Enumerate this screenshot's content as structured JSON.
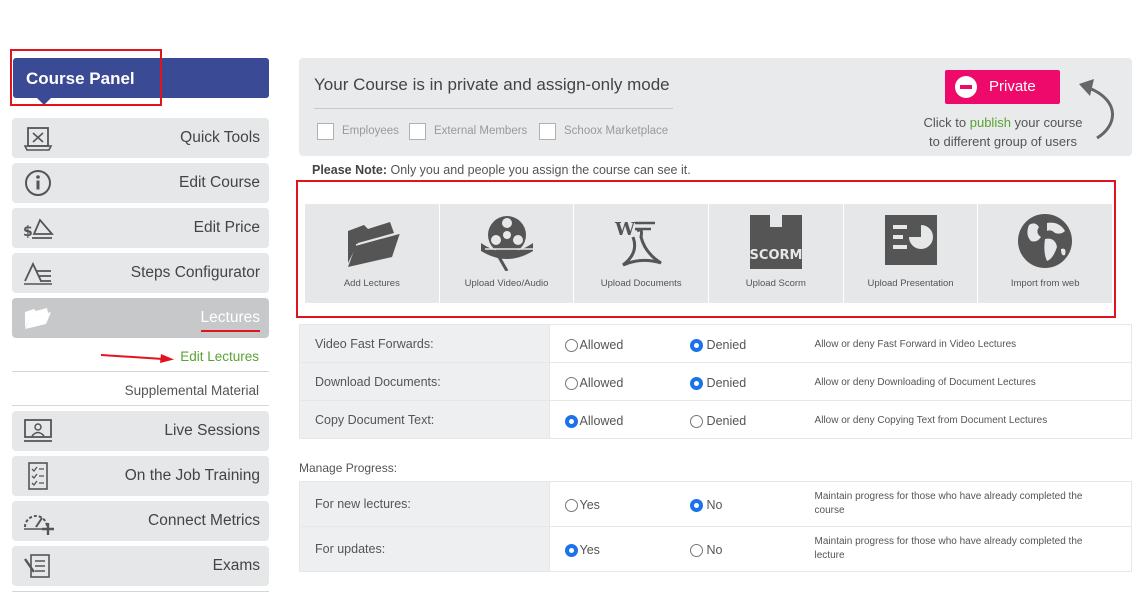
{
  "sidebar": {
    "panel_title": "Course Panel",
    "items": [
      {
        "label": "Quick Tools",
        "icon": "quick-tools-icon"
      },
      {
        "label": "Edit Course",
        "icon": "info-icon"
      },
      {
        "label": "Edit Price",
        "icon": "price-icon"
      },
      {
        "label": "Steps Configurator",
        "icon": "steps-icon"
      },
      {
        "label": "Lectures",
        "icon": "folder-icon",
        "active": true
      },
      {
        "label": "Live Sessions",
        "icon": "live-session-icon"
      },
      {
        "label": "On the Job Training",
        "icon": "checklist-icon"
      },
      {
        "label": "Connect Metrics",
        "icon": "gauge-icon"
      },
      {
        "label": "Exams",
        "icon": "exam-icon"
      }
    ],
    "sub_items": {
      "edit_lectures": "Edit Lectures",
      "supplemental": "Supplemental Material"
    }
  },
  "mode": {
    "title": "Your Course is in private and assign-only mode",
    "audiences": [
      "Employees",
      "External Members",
      "Schoox Marketplace"
    ],
    "private_button": "Private",
    "note_prefix": "Click to ",
    "note_link": "publish",
    "note_suffix": " your course",
    "note_line2": "to different group of users"
  },
  "please_note": {
    "bold": "Please Note:",
    "text": " Only you and people you assign the course can see it."
  },
  "tiles": [
    {
      "label": "Add Lectures",
      "icon": "folder-icon"
    },
    {
      "label": "Upload Video/Audio",
      "icon": "film-reel-icon"
    },
    {
      "label": "Upload Documents",
      "icon": "documents-icon"
    },
    {
      "label": "Upload Scorm",
      "icon": "scorm-box-icon"
    },
    {
      "label": "Upload Presentation",
      "icon": "presentation-icon"
    },
    {
      "label": "Import from web",
      "icon": "globe-icon"
    }
  ],
  "settings": [
    {
      "label": "Video Fast Forwards:",
      "options": [
        "Allowed",
        "Denied"
      ],
      "selected": "Denied",
      "desc": "Allow or deny Fast Forward in Video Lectures"
    },
    {
      "label": "Download Documents:",
      "options": [
        "Allowed",
        "Denied"
      ],
      "selected": "Denied",
      "desc": "Allow or deny Downloading of Document Lectures"
    },
    {
      "label": "Copy Document Text:",
      "options": [
        "Allowed",
        "Denied"
      ],
      "selected": "Allowed",
      "desc": "Allow or deny Copying Text from Document Lectures"
    }
  ],
  "manage_progress": {
    "title": "Manage Progress:",
    "rows": [
      {
        "label": "For new lectures:",
        "options": [
          "Yes",
          "No"
        ],
        "selected": "No",
        "desc": "Maintain progress for those who have already completed the course"
      },
      {
        "label": "For updates:",
        "options": [
          "Yes",
          "No"
        ],
        "selected": "Yes",
        "desc": "Maintain progress for those who have already completed the lecture"
      }
    ]
  },
  "colors": {
    "panel": "#3a4a94",
    "private": "#ee0a6a",
    "link_green": "#5aa233",
    "annotation_red": "#e0141e",
    "radio_blue": "#1a73e8"
  }
}
